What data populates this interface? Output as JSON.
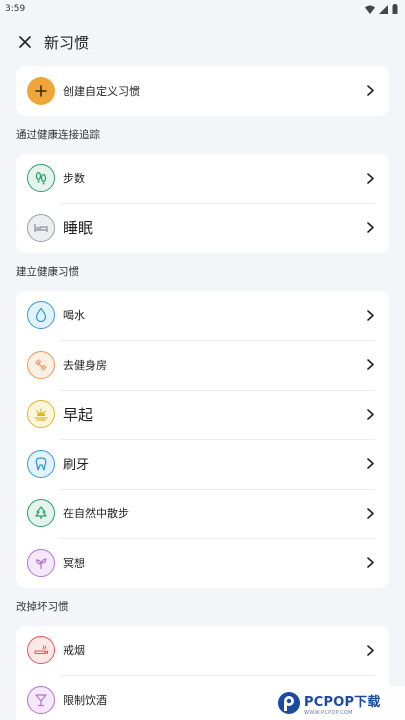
{
  "status_bar": {
    "time": "3:59"
  },
  "header": {
    "title": "新习惯"
  },
  "custom_habit": {
    "label": "创建自定义习惯"
  },
  "sections": {
    "health": {
      "title": "通过健康连接追踪",
      "items": [
        {
          "label": "步数",
          "icon": "footprints-icon"
        },
        {
          "label": "睡眠",
          "icon": "bed-icon"
        }
      ]
    },
    "build": {
      "title": "建立健康习惯",
      "items": [
        {
          "label": "喝水",
          "icon": "water-drop-icon"
        },
        {
          "label": "去健身房",
          "icon": "dumbbell-icon"
        },
        {
          "label": "早起",
          "icon": "sunrise-icon"
        },
        {
          "label": "刷牙",
          "icon": "tooth-icon"
        },
        {
          "label": "在自然中散步",
          "icon": "tree-icon"
        },
        {
          "label": "冥想",
          "icon": "meditation-sprout-icon"
        }
      ]
    },
    "quit": {
      "title": "改掉坏习惯",
      "items": [
        {
          "label": "戒烟",
          "icon": "cigarette-icon"
        },
        {
          "label": "限制饮酒",
          "icon": "cocktail-icon"
        }
      ]
    }
  },
  "watermark": {
    "brand": "PCPOP下载",
    "sub": "WWW.PCPOP.COM"
  },
  "colors": {
    "accent_orange": "#f0a53a",
    "green": "#2f9e6e",
    "blue": "#3a9ad0",
    "peach": "#e79a5a",
    "yellow": "#e0b52a",
    "red": "#df5a5a",
    "purple": "#b374cf"
  }
}
